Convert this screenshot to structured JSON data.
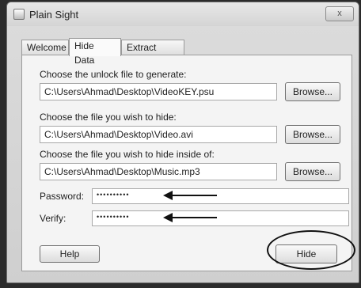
{
  "window": {
    "title": "Plain Sight",
    "close_label": "x"
  },
  "tabs": [
    {
      "label": "Welcome"
    },
    {
      "label": "Hide Data"
    },
    {
      "label": "Extract Data"
    }
  ],
  "hide_data": {
    "unlock_label": "Choose the unlock file to generate:",
    "unlock_value": "C:\\Users\\Ahmad\\Desktop\\VideoKEY.psu",
    "hide_label": "Choose the file you wish to hide:",
    "hide_value": "C:\\Users\\Ahmad\\Desktop\\Video.avi",
    "inside_label": "Choose the file you wish to hide inside of:",
    "inside_value": "C:\\Users\\Ahmad\\Desktop\\Music.mp3",
    "browse_label": "Browse...",
    "password_label": "Password:",
    "password_value": "••••••••••",
    "verify_label": "Verify:",
    "verify_value": "••••••••••",
    "help_label": "Help",
    "hide_button_label": "Hide"
  }
}
